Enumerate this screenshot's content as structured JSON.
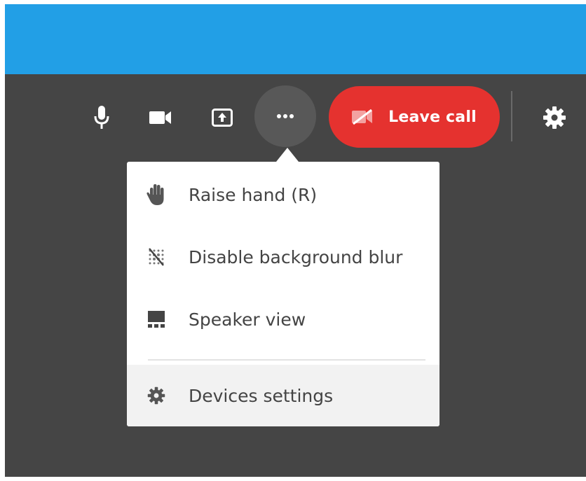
{
  "toolbar": {
    "leave_label": "Leave call",
    "colors": {
      "accent_blue": "#229fe6",
      "leave_red": "#e5322f",
      "background": "#454545"
    },
    "icons": [
      "microphone-icon",
      "video-camera-icon",
      "screen-share-icon",
      "more-options-icon",
      "hangup-icon",
      "gear-icon"
    ]
  },
  "menu": {
    "items": [
      {
        "label": "Raise hand (R)",
        "icon": "hand-icon"
      },
      {
        "label": "Disable background blur",
        "icon": "blur-off-icon"
      },
      {
        "label": "Speaker view",
        "icon": "speaker-view-icon"
      },
      {
        "label": "Devices settings",
        "icon": "gear-icon",
        "highlighted": true
      }
    ]
  }
}
